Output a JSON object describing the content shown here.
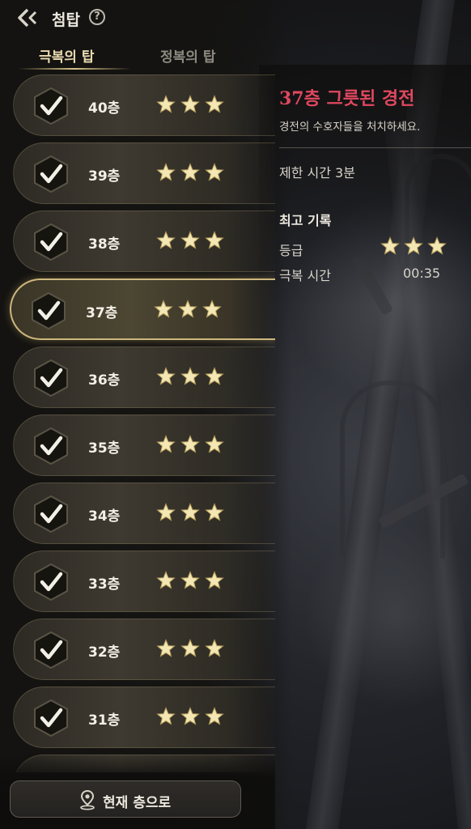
{
  "header": {
    "title": "첨탑",
    "help_symbol": "?"
  },
  "tabs": [
    {
      "label": "극복의 탑",
      "active": true
    },
    {
      "label": "정복의 탑",
      "active": false
    }
  ],
  "floors": [
    {
      "label": "40층",
      "cleared": true,
      "stars": 3
    },
    {
      "label": "39층",
      "cleared": true,
      "stars": 3
    },
    {
      "label": "38층",
      "cleared": true,
      "stars": 3
    },
    {
      "label": "37층",
      "cleared": true,
      "stars": 3,
      "selected": true
    },
    {
      "label": "36층",
      "cleared": true,
      "stars": 3
    },
    {
      "label": "35층",
      "cleared": true,
      "stars": 3
    },
    {
      "label": "34층",
      "cleared": true,
      "stars": 3
    },
    {
      "label": "33층",
      "cleared": true,
      "stars": 3
    },
    {
      "label": "32층",
      "cleared": true,
      "stars": 3
    },
    {
      "label": "31층",
      "cleared": true,
      "stars": 3
    }
  ],
  "detail": {
    "title": "37층 그릇된 경전",
    "description": "경전의 수호자들을 처치하세요.",
    "time_limit": "제한 시간 3분",
    "best_record_title": "최고 기록",
    "grade_label": "등급",
    "grade_stars": 3,
    "conquer_time_label": "극복 시간",
    "conquer_time_value": "00:35"
  },
  "bottom_button": {
    "label": "현재 층으로"
  },
  "colors": {
    "accent_red": "#e0485f",
    "star_gold": "#f3e7b4",
    "tab_active": "#e9dbb0",
    "selected_border": "#cdb77d"
  },
  "icons": {
    "back": "back-chevron-icon",
    "help": "help-icon",
    "cleared": "checkmark-badge-icon",
    "star": "star-icon",
    "pin": "location-pin-icon"
  }
}
